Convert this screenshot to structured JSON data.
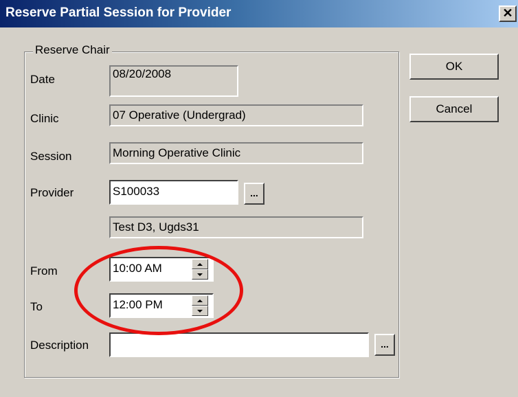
{
  "window": {
    "title": "Reserve Partial Session for Provider",
    "close_glyph": "✕"
  },
  "buttons": {
    "ok": "OK",
    "cancel": "Cancel"
  },
  "group": {
    "legend": "Reserve Chair",
    "date": {
      "label": "Date",
      "value": "08/20/2008"
    },
    "clinic": {
      "label": "Clinic",
      "value": "07 Operative (Undergrad)"
    },
    "session": {
      "label": "Session",
      "value": "Morning Operative Clinic"
    },
    "provider": {
      "label": "Provider",
      "value": "S100033",
      "name": "Test D3, Ugds31",
      "browse": "..."
    },
    "from": {
      "label": "From",
      "value": "10:00 AM"
    },
    "to": {
      "label": "To",
      "value": "12:00 PM"
    },
    "description": {
      "label": "Description",
      "value": "",
      "browse": "..."
    }
  },
  "colors": {
    "dialog_bg": "#d4d0c8",
    "titlebar_start": "#0a246a",
    "titlebar_end": "#a6caf0",
    "annotation": "#e8100e"
  },
  "icons": {
    "close": "close-icon",
    "spin_up": "spin-up-icon",
    "spin_down": "spin-down-icon"
  }
}
